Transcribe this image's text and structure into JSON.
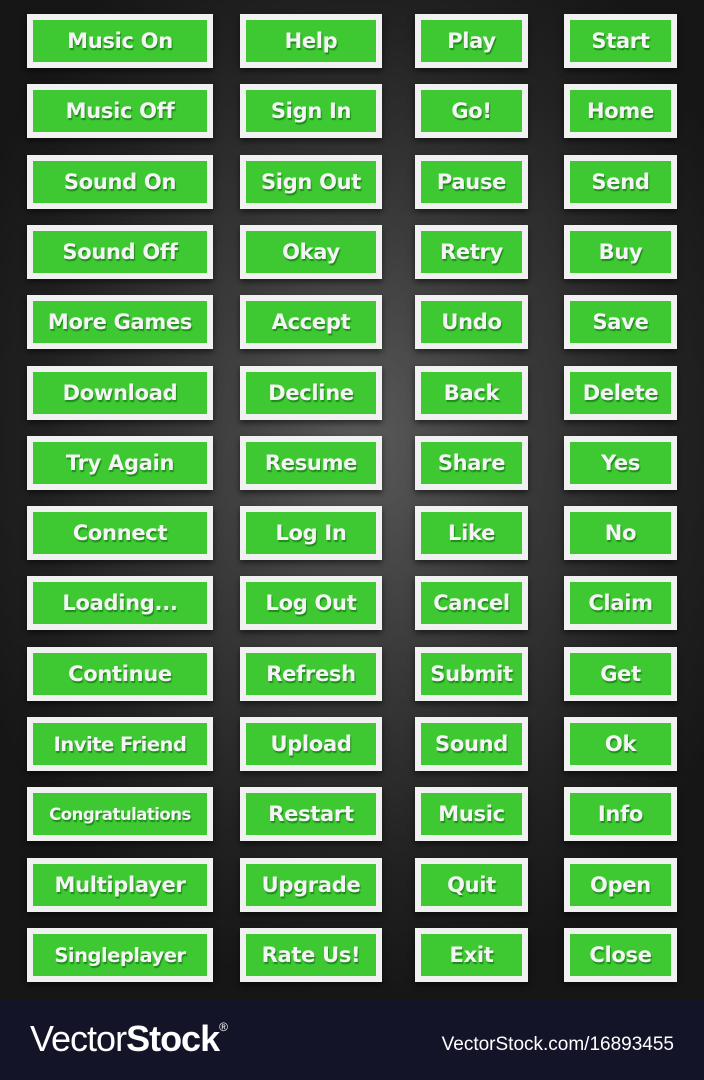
{
  "colors": {
    "button_frame": "#f1f1f1",
    "button_face": "#3ec933",
    "button_text": "#f4f4f4",
    "background": "#2e2e2e",
    "footer_bg": "#131428"
  },
  "columns": [
    [
      "Music On",
      "Music Off",
      "Sound On",
      "Sound Off",
      "More Games",
      "Download",
      "Try Again",
      "Connect",
      "Loading...",
      "Continue",
      "Invite Friend",
      "Congratulations",
      "Multiplayer",
      "Singleplayer"
    ],
    [
      "Help",
      "Sign In",
      "Sign Out",
      "Okay",
      "Accept",
      "Decline",
      "Resume",
      "Log In",
      "Log Out",
      "Refresh",
      "Upload",
      "Restart",
      "Upgrade",
      "Rate Us!"
    ],
    [
      "Play",
      "Go!",
      "Pause",
      "Retry",
      "Undo",
      "Back",
      "Share",
      "Like",
      "Cancel",
      "Submit",
      "Sound",
      "Music",
      "Quit",
      "Exit"
    ],
    [
      "Start",
      "Home",
      "Send",
      "Buy",
      "Save",
      "Delete",
      "Yes",
      "No",
      "Claim",
      "Get",
      "Ok",
      "Info",
      "Open",
      "Close"
    ]
  ],
  "footer": {
    "brand_thin": "Vector",
    "brand_bold": "Stock",
    "brand_mark": "®",
    "reference": "VectorStock.com/16893455"
  }
}
